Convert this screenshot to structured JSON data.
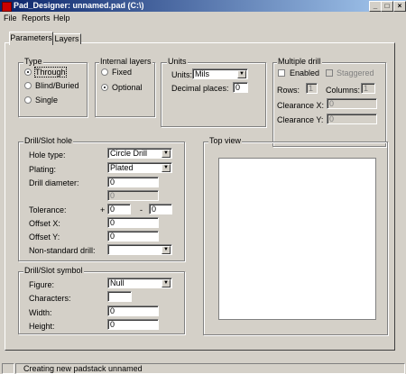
{
  "window": {
    "title": "Pad_Designer: unnamed.pad (C:\\)"
  },
  "menu": [
    "File",
    "Reports",
    "Help"
  ],
  "tabs": [
    "Parameters",
    "Layers"
  ],
  "type_group": {
    "title": "Type",
    "options": [
      "Through",
      "Blind/Buried",
      "Single"
    ],
    "selected": "Through"
  },
  "internal_layers": {
    "title": "Internal layers",
    "options": [
      "Fixed",
      "Optional"
    ],
    "selected": "Optional"
  },
  "units": {
    "title": "Units",
    "units_label": "Units:",
    "units_value": "Mils",
    "decimal_label": "Decimal places:",
    "decimal_value": "0"
  },
  "multiple_drill": {
    "title": "Multiple drill",
    "enabled_label": "Enabled",
    "staggered_label": "Staggered",
    "rows_label": "Rows:",
    "rows_value": "1",
    "columns_label": "Columns:",
    "columns_value": "1",
    "clearance_x_label": "Clearance X:",
    "clearance_x_value": "0",
    "clearance_y_label": "Clearance Y:",
    "clearance_y_value": "0"
  },
  "drill_slot_hole": {
    "title": "Drill/Slot hole",
    "hole_type_label": "Hole type:",
    "hole_type_value": "Circle Drill",
    "plating_label": "Plating:",
    "plating_value": "Plated",
    "drill_diameter_label": "Drill diameter:",
    "drill_diameter_value": "0",
    "drill_diameter_2_value": "0",
    "tolerance_label": "Tolerance:",
    "tolerance_plus": "+",
    "tolerance_plus_value": "0",
    "tolerance_minus": "-",
    "tolerance_minus_value": "0",
    "offset_x_label": "Offset X:",
    "offset_x_value": "0",
    "offset_y_label": "Offset Y:",
    "offset_y_value": "0",
    "nonstandard_label": "Non-standard drill:",
    "nonstandard_value": ""
  },
  "drill_slot_symbol": {
    "title": "Drill/Slot symbol",
    "figure_label": "Figure:",
    "figure_value": "Null",
    "characters_label": "Characters:",
    "characters_value": "",
    "width_label": "Width:",
    "width_value": "0",
    "height_label": "Height:",
    "height_value": "0"
  },
  "top_view": {
    "title": "Top view"
  },
  "status": {
    "text": "Creating new padstack unnamed"
  }
}
